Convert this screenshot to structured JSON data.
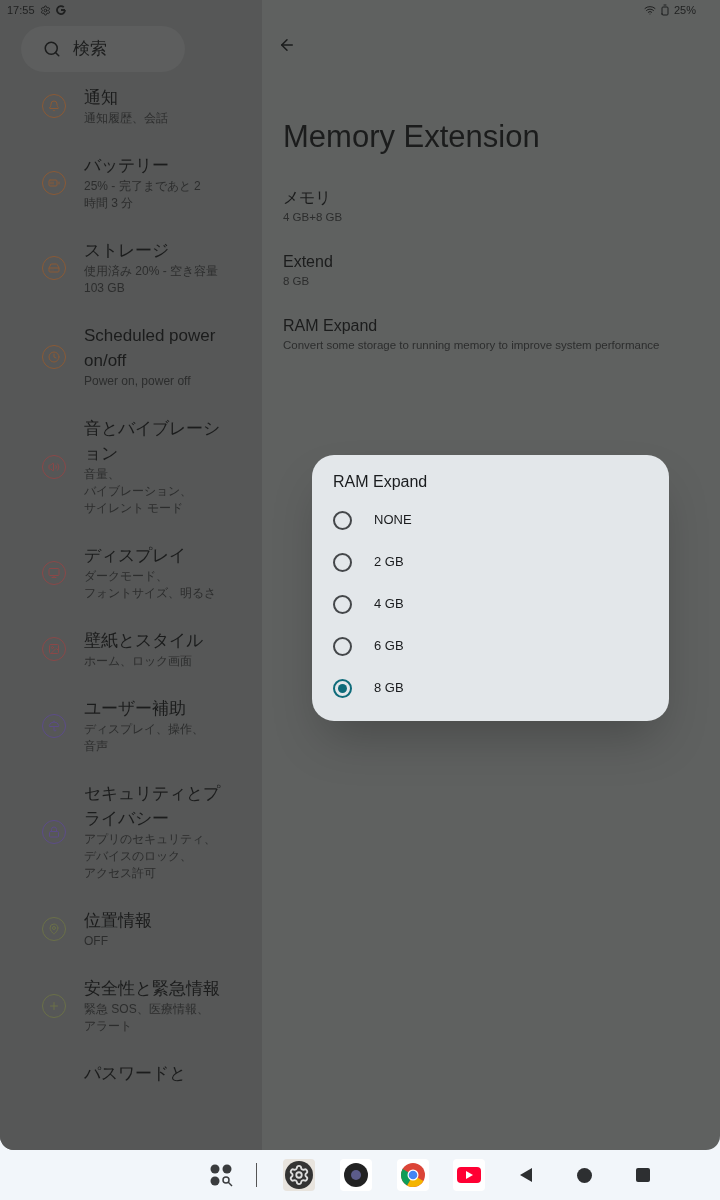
{
  "status_bar": {
    "time": "17:55",
    "battery": "25%"
  },
  "search": {
    "placeholder": "検索"
  },
  "sidebar": {
    "items": [
      {
        "title": "通知",
        "subtitle": [
          "通知履歴、会話"
        ],
        "color": "#8a5a36"
      },
      {
        "title": "バッテリー",
        "subtitle": [
          "25% - 完了まであと 2",
          "時間 3 分"
        ],
        "color": "#8a5a36"
      },
      {
        "title": "ストレージ",
        "subtitle": [
          "使用済み 20% - 空き容量",
          "103 GB"
        ],
        "color": "#8a5a36"
      },
      {
        "title": "Scheduled power on/off",
        "subtitle": [
          "Power on, power off"
        ],
        "color": "#8a5a36"
      },
      {
        "title": "音とバイブレーション",
        "subtitle": [
          "音量、",
          "バイブレーション、",
          "サイレント モード"
        ],
        "color": "#8a4848"
      },
      {
        "title": "ディスプレイ",
        "subtitle": [
          "ダークモード、",
          "フォントサイズ、明るさ"
        ],
        "color": "#8a4848"
      },
      {
        "title": "壁紙とスタイル",
        "subtitle": [
          "ホーム、ロック画面"
        ],
        "color": "#8a4848"
      },
      {
        "title": "ユーザー補助",
        "subtitle": [
          "ディスプレイ、操作、",
          "音声"
        ],
        "color": "#5c4c88"
      },
      {
        "title": "セキュリティとプライバシー",
        "subtitle": [
          "アプリのセキュリティ、",
          "デバイスのロック、",
          "アクセス許可"
        ],
        "color": "#5c4c88"
      },
      {
        "title": "位置情報",
        "subtitle": [
          "OFF"
        ],
        "color": "#6a7048"
      },
      {
        "title": "安全性と緊急情報",
        "subtitle": [
          "緊急 SOS、医療情報、",
          "アラート"
        ],
        "color": "#6a7048"
      },
      {
        "title": "パスワードと"
      }
    ]
  },
  "page": {
    "title": "Memory Extension",
    "settings": [
      {
        "title": "メモリ",
        "subtitle": "4 GB+8 GB"
      },
      {
        "title": "Extend",
        "subtitle": "8 GB"
      },
      {
        "title": "RAM Expand",
        "subtitle": "Convert some storage to running memory to improve system performance"
      }
    ]
  },
  "dialog": {
    "title": "RAM Expand",
    "options": [
      {
        "label": "NONE",
        "selected": false
      },
      {
        "label": "2 GB",
        "selected": false
      },
      {
        "label": "4 GB",
        "selected": false
      },
      {
        "label": "6 GB",
        "selected": false
      },
      {
        "label": "8 GB",
        "selected": true
      }
    ]
  }
}
